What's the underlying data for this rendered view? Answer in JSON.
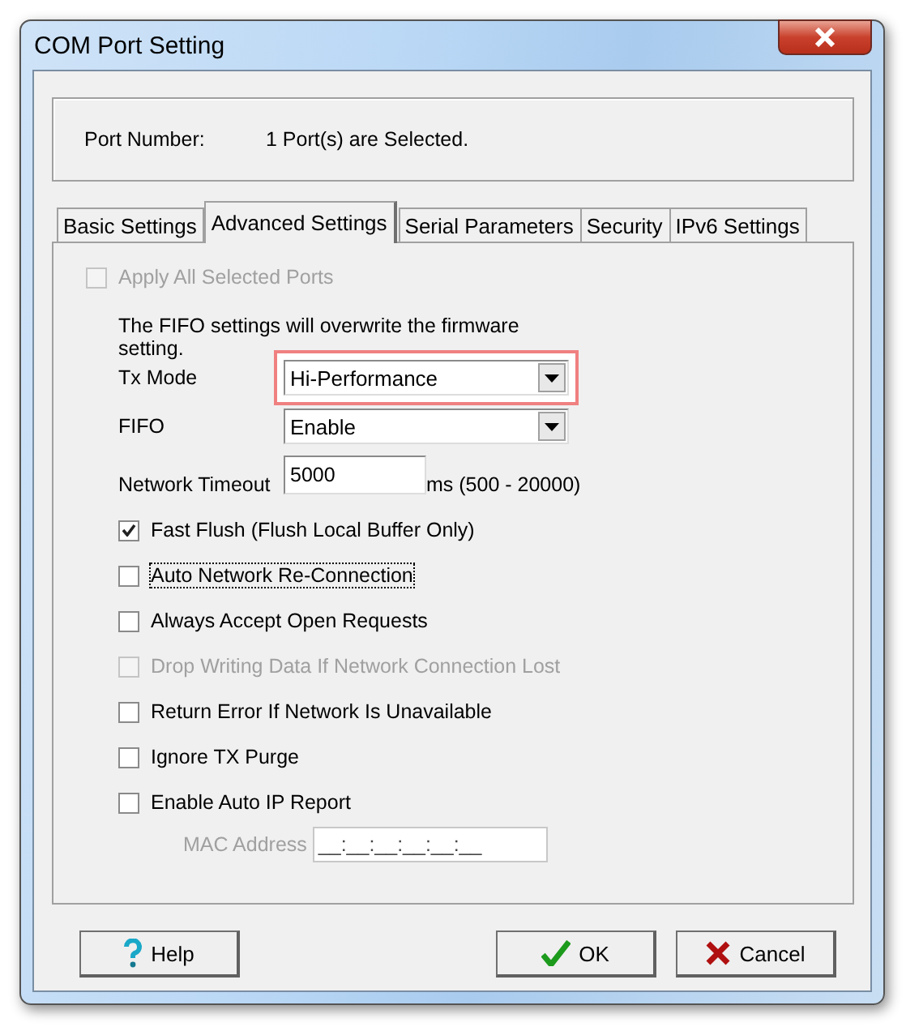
{
  "window": {
    "title": "COM Port Setting"
  },
  "port": {
    "label": "Port Number:",
    "value": "1 Port(s) are Selected."
  },
  "tabs": [
    {
      "label": "Basic Settings",
      "selected": false
    },
    {
      "label": "Advanced Settings",
      "selected": true
    },
    {
      "label": "Serial Parameters",
      "selected": false
    },
    {
      "label": "Security",
      "selected": false
    },
    {
      "label": "IPv6 Settings",
      "selected": false
    }
  ],
  "apply_all": {
    "label": "Apply All Selected Ports",
    "checked": false,
    "disabled": true,
    "focused": false
  },
  "note": "The FIFO settings will overwrite the firmware setting.",
  "tx_mode": {
    "label": "Tx Mode",
    "value": "Hi-Performance",
    "highlighted": true
  },
  "fifo": {
    "label": "FIFO",
    "value": "Enable",
    "highlighted": false
  },
  "network_timeout": {
    "label": "Network Timeout",
    "value": "5000",
    "hint": "ms (500 - 20000)"
  },
  "options": [
    {
      "label": "Fast Flush (Flush Local Buffer Only)",
      "checked": true,
      "disabled": false,
      "focused": false
    },
    {
      "label": "Auto Network Re-Connection",
      "checked": false,
      "disabled": false,
      "focused": true
    },
    {
      "label": "Always Accept Open Requests",
      "checked": false,
      "disabled": false,
      "focused": false
    },
    {
      "label": "Drop Writing Data If Network Connection Lost",
      "checked": false,
      "disabled": true,
      "focused": false
    },
    {
      "label": "Return Error If Network Is Unavailable",
      "checked": false,
      "disabled": false,
      "focused": false
    },
    {
      "label": "Ignore TX Purge",
      "checked": false,
      "disabled": false,
      "focused": false
    },
    {
      "label": "Enable Auto IP Report",
      "checked": false,
      "disabled": false,
      "focused": false
    }
  ],
  "mac_address": {
    "label": "MAC Address",
    "value": "__:__:__:__:__:__",
    "disabled": true
  },
  "buttons": [
    {
      "kind": "help",
      "label": "Help"
    },
    {
      "kind": "ok",
      "label": "OK"
    },
    {
      "kind": "cancel",
      "label": "Cancel"
    }
  ]
}
